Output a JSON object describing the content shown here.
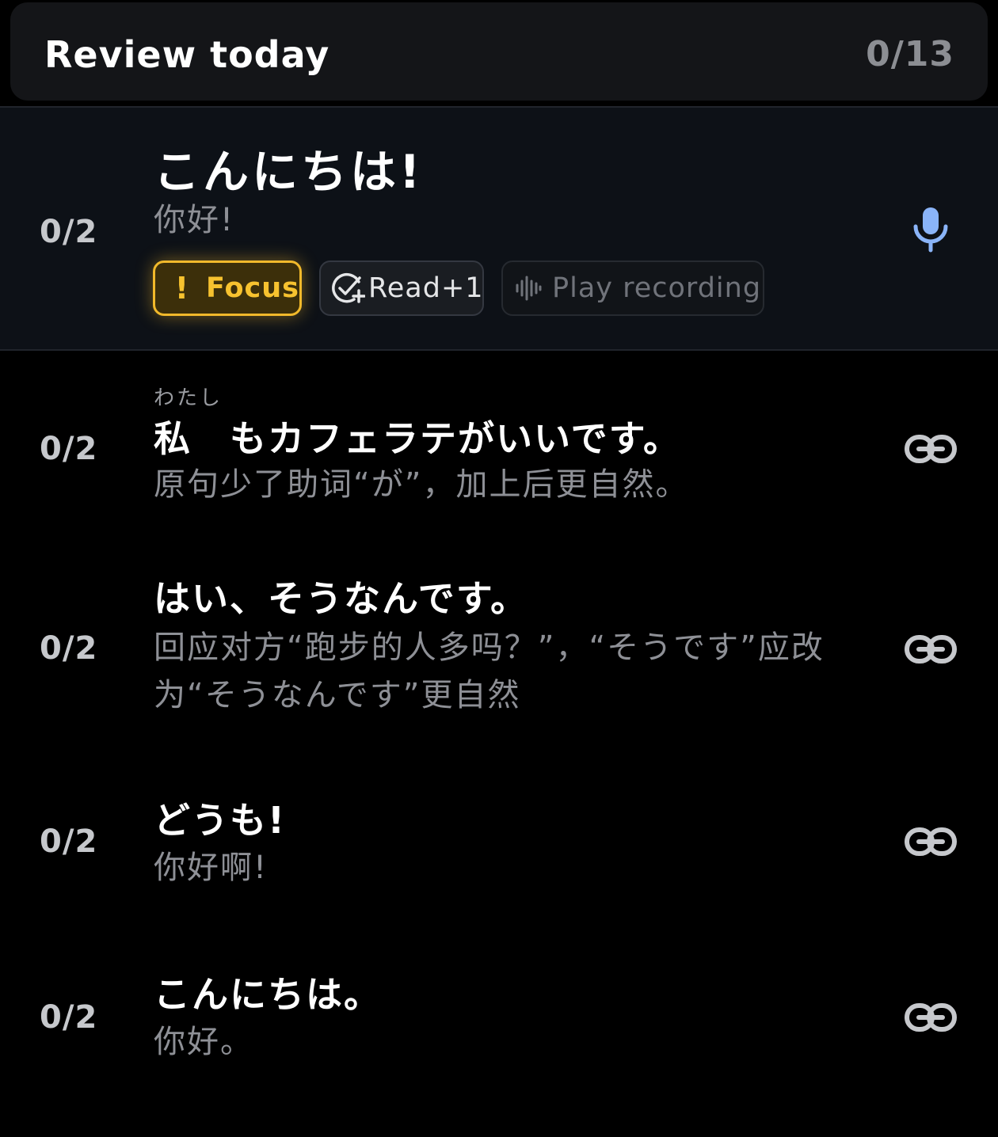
{
  "header": {
    "title": "Review today",
    "count": "0/13"
  },
  "items": [
    {
      "count": "0/2",
      "japanese": "こんにちは!",
      "chinese": "你好!",
      "chips": {
        "focus": "Focus",
        "read": "Read+1",
        "play": "Play recording"
      },
      "action_icon": "microphone-icon"
    },
    {
      "count": "0/2",
      "ruby": "わたし",
      "japanese": "私　もカフェラテがいいです。",
      "chinese": "原句少了助词“が”，加上后更自然。",
      "action_icon": "link-icon"
    },
    {
      "count": "0/2",
      "japanese": "はい、そうなんです。",
      "chinese_line1": "回应对方“跑步的人多吗？”，“そうです”应改",
      "chinese_line2": "为“そうなんです”更自然",
      "action_icon": "link-icon"
    },
    {
      "count": "0/2",
      "japanese": "どうも!",
      "chinese": "你好啊!",
      "action_icon": "link-icon"
    },
    {
      "count": "0/2",
      "japanese": "こんにちは。",
      "chinese": "你好。",
      "action_icon": "link-icon"
    }
  ],
  "colors": {
    "background": "#000000",
    "header_bg": "#141518",
    "active_row_bg": "#0d1117",
    "focus_accent": "#f1b92b",
    "mic_blue": "#8ab4f8",
    "muted_text": "#8e9096"
  }
}
